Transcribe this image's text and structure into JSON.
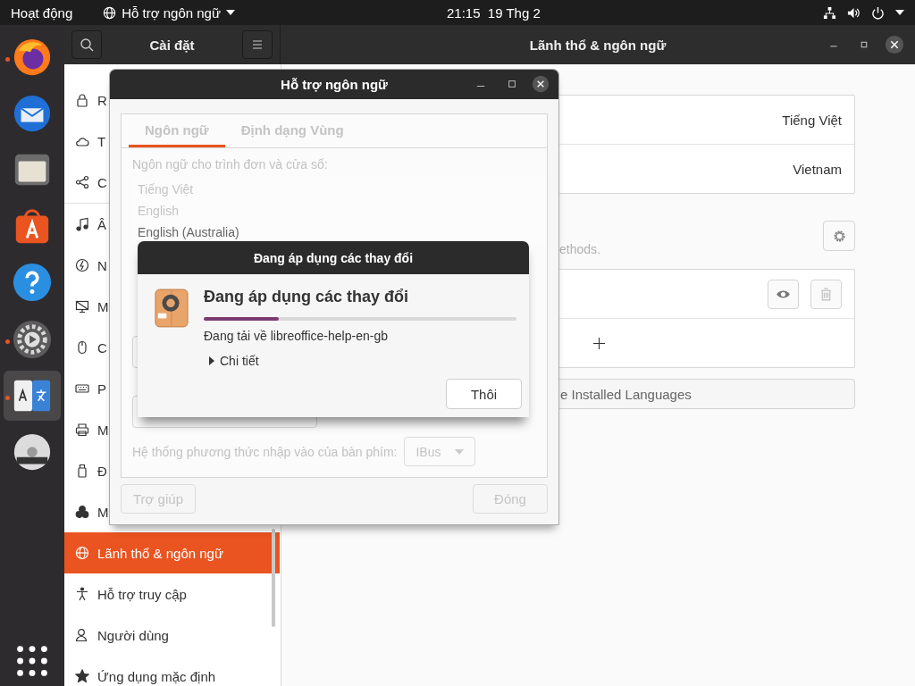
{
  "top_bar": {
    "activities": "Hoạt động",
    "app_menu": "Hỗ trợ ngôn ngữ",
    "clock": "21:15  19 Thg 2"
  },
  "dock": [
    {
      "kind": "firefox",
      "running": true,
      "selected": false
    },
    {
      "kind": "mail",
      "running": false,
      "selected": false
    },
    {
      "kind": "files",
      "running": false,
      "selected": false
    },
    {
      "kind": "store",
      "running": false,
      "selected": false
    },
    {
      "kind": "help",
      "running": false,
      "selected": false
    },
    {
      "kind": "settings",
      "running": true,
      "selected": false
    },
    {
      "kind": "language",
      "running": true,
      "selected": true
    },
    {
      "kind": "disc",
      "running": false,
      "selected": false
    },
    {
      "kind": "grid",
      "running": false,
      "selected": false
    }
  ],
  "settings": {
    "title": "Cài đặt",
    "page_title": "Lãnh thổ & ngôn ngữ",
    "sidebar": [
      {
        "items": [
          {
            "kind": "lock",
            "label": "R",
            "selected": false
          },
          {
            "kind": "cloud",
            "label": "T",
            "selected": false
          },
          {
            "kind": "share",
            "label": "C",
            "selected": false
          }
        ]
      },
      {
        "items": [
          {
            "kind": "music",
            "label": "Â",
            "selected": false
          },
          {
            "kind": "power",
            "label": "N",
            "selected": false
          },
          {
            "kind": "display",
            "label": "M",
            "selected": false
          },
          {
            "kind": "mouse",
            "label": "C",
            "selected": false
          },
          {
            "kind": "keyboard",
            "label": "P",
            "selected": false
          },
          {
            "kind": "printer",
            "label": "M",
            "selected": false
          },
          {
            "kind": "usb",
            "label": "Đ",
            "selected": false
          },
          {
            "kind": "circles",
            "label": "M",
            "selected": false
          },
          {
            "kind": "globe",
            "label": "Lãnh thổ & ngôn ngữ",
            "selected": true
          },
          {
            "kind": "person",
            "label": "Hỗ trợ truy cập",
            "selected": false
          },
          {
            "kind": "user",
            "label": "Người dùng",
            "selected": false
          },
          {
            "kind": "star",
            "label": "Ứng dụng mặc định",
            "selected": false
          }
        ]
      }
    ],
    "language_value": "Tiếng Việt",
    "formats_value": "Vietnam",
    "input_hint": "ethods.",
    "manage_button": "e Installed Languages"
  },
  "language_dialog": {
    "title": "Hỗ trợ ngôn ngữ",
    "tabs": [
      {
        "label": "Ngôn ngữ",
        "selected": true
      },
      {
        "label": "Định dạng Vùng",
        "selected": false
      }
    ],
    "list_label": "Ngôn ngữ cho trình đơn và cửa sổ:",
    "languages": [
      {
        "label": "Tiếng Việt",
        "disabled": true
      },
      {
        "label": "English",
        "disabled": true
      },
      {
        "label": "English (Australia)",
        "disabled": false
      }
    ],
    "input_label": "Hệ thống phương thức nhập vào của bàn phím:",
    "input_value": "IBus",
    "help_button": "Trợ giúp",
    "close_button": "Đóng"
  },
  "progress_dialog": {
    "title": "Đang áp dụng các thay đổi",
    "heading": "Đang áp dụng các thay đổi",
    "level": 0.24,
    "status": "Đang tải về libreoffice-help-en-gb",
    "details": "Chi tiết",
    "expanded": false,
    "cancel_button": "Thôi"
  }
}
